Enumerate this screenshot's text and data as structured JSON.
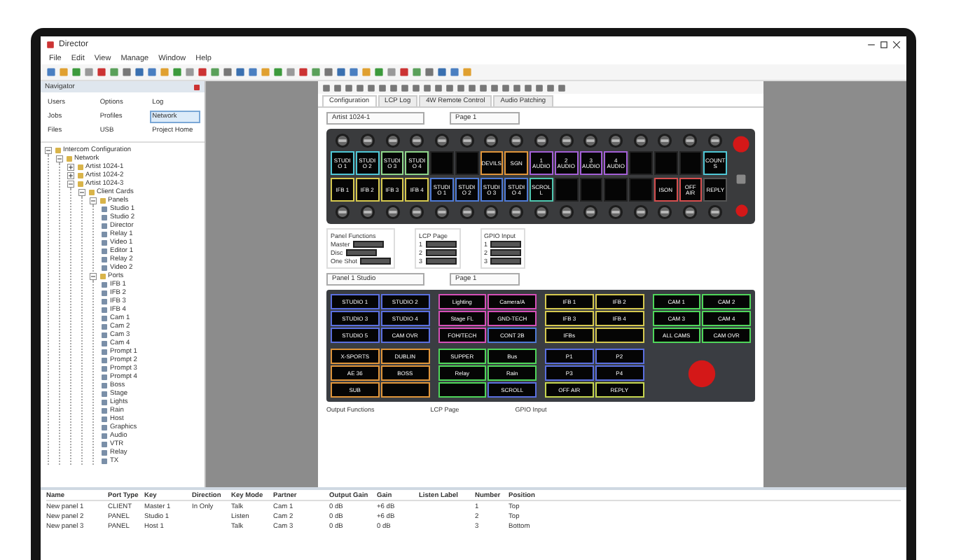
{
  "window": {
    "title": "Director"
  },
  "menu": [
    "File",
    "Edit",
    "View",
    "Manage",
    "Window",
    "Help"
  ],
  "navigator": {
    "title": "Navigator",
    "tools": [
      {
        "label": "Users",
        "selected": false
      },
      {
        "label": "Options",
        "selected": false
      },
      {
        "label": "Log",
        "selected": false
      },
      {
        "label": "Jobs",
        "selected": false
      },
      {
        "label": "Profiles",
        "selected": false
      },
      {
        "label": "Network",
        "selected": true
      },
      {
        "label": "Files",
        "selected": false
      },
      {
        "label": "USB",
        "selected": false
      },
      {
        "label": "Project Home",
        "selected": false
      }
    ],
    "tree": [
      {
        "label": "Intercom Configuration",
        "expanded": true,
        "children": [
          {
            "label": "Network",
            "expanded": true,
            "children": [
              {
                "label": "Artist 1024-1",
                "expanded": false
              },
              {
                "label": "Artist 1024-2",
                "expanded": false
              },
              {
                "label": "Artist 1024-3",
                "expanded": true,
                "children": [
                  {
                    "label": "Client Cards",
                    "expanded": true,
                    "children": [
                      {
                        "label": "Panels",
                        "expanded": true,
                        "children": [
                          {
                            "label": "Studio 1"
                          },
                          {
                            "label": "Studio 2"
                          },
                          {
                            "label": "Director"
                          },
                          {
                            "label": "Relay 1"
                          },
                          {
                            "label": "Video 1"
                          },
                          {
                            "label": "Editor 1"
                          },
                          {
                            "label": "Relay 2"
                          },
                          {
                            "label": "Video 2"
                          }
                        ]
                      },
                      {
                        "label": "Ports",
                        "expanded": true,
                        "children": [
                          {
                            "label": "IFB 1"
                          },
                          {
                            "label": "IFB 2"
                          },
                          {
                            "label": "IFB 3"
                          },
                          {
                            "label": "IFB 4"
                          },
                          {
                            "label": "Cam 1"
                          },
                          {
                            "label": "Cam 2"
                          },
                          {
                            "label": "Cam 3"
                          },
                          {
                            "label": "Cam 4"
                          },
                          {
                            "label": "Prompt 1"
                          },
                          {
                            "label": "Prompt 2"
                          },
                          {
                            "label": "Prompt 3"
                          },
                          {
                            "label": "Prompt 4"
                          },
                          {
                            "label": "Boss"
                          },
                          {
                            "label": "Stage"
                          },
                          {
                            "label": "Lights"
                          },
                          {
                            "label": "Rain"
                          },
                          {
                            "label": "Host"
                          },
                          {
                            "label": "Graphics"
                          },
                          {
                            "label": "Audio"
                          },
                          {
                            "label": "VTR"
                          },
                          {
                            "label": "Relay"
                          },
                          {
                            "label": "TX"
                          }
                        ]
                      }
                    ]
                  }
                ]
              }
            ]
          }
        ]
      }
    ]
  },
  "document": {
    "tabs": [
      {
        "label": "Configuration",
        "selected": true
      },
      {
        "label": "LCP Log",
        "selected": false
      },
      {
        "label": "4W Remote Control",
        "selected": false
      },
      {
        "label": "Audio Patching",
        "selected": false
      }
    ],
    "panel_1": {
      "selector": "Artist 1024-1",
      "page": "Page 1",
      "rows": [
        [
          {
            "label": "STUDIO 1",
            "color": "#4fc7d6"
          },
          {
            "label": "STUDIO 2",
            "color": "#4fc7d6"
          },
          {
            "label": "STUDIO 3",
            "color": "#8fd68a"
          },
          {
            "label": "STUDIO 4",
            "color": "#8fd68a"
          },
          {},
          {},
          {
            "label": "DEVILS",
            "color": "#e0953a"
          },
          {
            "label": "SGN",
            "color": "#e0953a"
          },
          {
            "label": "1 AUDIO",
            "color": "#a35fd6"
          },
          {
            "label": "2 AUDIO",
            "color": "#a35fd6"
          },
          {
            "label": "3 AUDIO",
            "color": "#a35fd6"
          },
          {
            "label": "4 AUDIO",
            "color": "#a35fd6"
          },
          {},
          {},
          {},
          {
            "label": "COUNTS",
            "color": "#4fc7d6"
          }
        ],
        [
          {
            "label": "IFB 1",
            "color": "#d6c94f"
          },
          {
            "label": "IFB 2",
            "color": "#d6c94f"
          },
          {
            "label": "IFB 3",
            "color": "#d6c94f"
          },
          {
            "label": "IFB 4",
            "color": "#d6c94f"
          },
          {
            "label": "STUDIO 1",
            "color": "#4f7bd6"
          },
          {
            "label": "STUDIO 2",
            "color": "#4f7bd6"
          },
          {
            "label": "STUDIO 3",
            "color": "#4f7bd6"
          },
          {
            "label": "STUDIO 4",
            "color": "#4f7bd6"
          },
          {
            "label": "SCROLL",
            "color": "#4fc7b0"
          },
          {},
          {},
          {},
          {},
          {
            "label": "ISON",
            "color": "#d64f4f"
          },
          {
            "label": "OFF AIR",
            "color": "#d64f4f"
          },
          {
            "label": "REPLY",
            "color": "#555555"
          }
        ]
      ],
      "groups": [
        {
          "title": "Panel Functions",
          "items": [
            "Master",
            "Disc",
            "One Shot"
          ]
        },
        {
          "title": "LCP Page",
          "items": [
            "1",
            "2",
            "3"
          ]
        },
        {
          "title": "GPIO Input",
          "items": [
            "1",
            "2",
            "3"
          ]
        }
      ]
    },
    "panel_2": {
      "selector": "Panel 1 Studio",
      "page": "Page 1",
      "sections": [
        [
          {
            "label": "STUDIO 1",
            "color": "#5a6fe0"
          },
          {
            "label": "STUDIO 2",
            "color": "#5a6fe0"
          },
          {
            "label": "STUDIO 3",
            "color": "#5a6fe0"
          },
          {
            "label": "STUDIO 4",
            "color": "#5a6fe0"
          },
          {
            "label": "STUDIO 5",
            "color": "#5a6fe0"
          },
          {
            "label": "CAM OVR",
            "color": "#5a6fe0"
          }
        ],
        [
          {
            "label": "Lighting",
            "color": "#d64fb8"
          },
          {
            "label": "Camera/A",
            "color": "#d64fb8"
          },
          {
            "label": "Stage FL",
            "color": "#d64fb8"
          },
          {
            "label": "GND-TECH",
            "color": "#d64fb8"
          },
          {
            "label": "FOH/TECH",
            "color": "#d64fb8"
          },
          {
            "label": "CONT 2B",
            "color": "#4f7bd6"
          }
        ],
        [
          {
            "label": "IFB 1",
            "color": "#d6c94f"
          },
          {
            "label": "IFB 2",
            "color": "#d6c94f"
          },
          {
            "label": "IFB 3",
            "color": "#d6c94f"
          },
          {
            "label": "IFB 4",
            "color": "#d6c94f"
          },
          {
            "label": "IFBs",
            "color": "#d6c94f"
          },
          {
            "color": "#d6c94f"
          }
        ],
        [
          {
            "label": "CAM 1",
            "color": "#4fd65a"
          },
          {
            "label": "CAM 2",
            "color": "#4fd65a"
          },
          {
            "label": "CAM 3",
            "color": "#4fd65a"
          },
          {
            "label": "CAM 4",
            "color": "#4fd65a"
          },
          {
            "label": "ALL CAMS",
            "color": "#4fd65a"
          },
          {
            "label": "CAM OVR",
            "color": "#4fd65a"
          }
        ],
        [
          {
            "label": "X-SPORTS",
            "color": "#e0953a"
          },
          {
            "label": "DUBLIN",
            "color": "#e0953a"
          },
          {
            "label": "AE 36",
            "color": "#e0953a"
          },
          {
            "label": "BOSS",
            "color": "#e0953a"
          },
          {
            "label": "SUB",
            "color": "#e0953a"
          },
          {
            "color": "#e0953a"
          }
        ],
        [
          {
            "label": "SUPPER",
            "color": "#4fd65a"
          },
          {
            "label": "Bus",
            "color": "#4fd65a"
          },
          {
            "label": "Relay",
            "color": "#4fd65a"
          },
          {
            "label": "Rain",
            "color": "#4fd65a"
          },
          {
            "color": "#4fd65a"
          },
          {
            "label": "SCROLL",
            "color": "#5a6fe0"
          }
        ],
        [
          {
            "label": "P1",
            "color": "#5a6fe0"
          },
          {
            "label": "P2",
            "color": "#5a6fe0"
          },
          {
            "label": "P3",
            "color": "#5a6fe0"
          },
          {
            "label": "P4",
            "color": "#5a6fe0"
          },
          {
            "label": "OFF AIR",
            "color": "#c6d64f"
          },
          {
            "label": "REPLY",
            "color": "#c6d64f"
          }
        ]
      ],
      "footer": [
        "Output Functions",
        "LCP Page",
        "GPIO Input"
      ]
    }
  },
  "properties": {
    "columns": [
      "Name",
      "Port Type",
      "Key",
      "Direction",
      "Key Mode",
      "Partner",
      "Output Gain",
      "Gain",
      "Listen Label",
      "Number",
      "Position"
    ],
    "rows": [
      [
        "New panel 1",
        "CLIENT",
        "Master 1",
        "In Only",
        "Talk",
        "Cam 1",
        "0 dB",
        "+6 dB",
        "",
        "1",
        "Top"
      ],
      [
        "New panel 2",
        "PANEL",
        "Studio 1",
        "",
        "Listen",
        "Cam 2",
        "0 dB",
        "+6 dB",
        "",
        "2",
        "Top"
      ],
      [
        "New panel 3",
        "PANEL",
        "Host 1",
        "",
        "Talk",
        "Cam 3",
        "0 dB",
        "0 dB",
        "",
        "3",
        "Bottom"
      ]
    ]
  }
}
